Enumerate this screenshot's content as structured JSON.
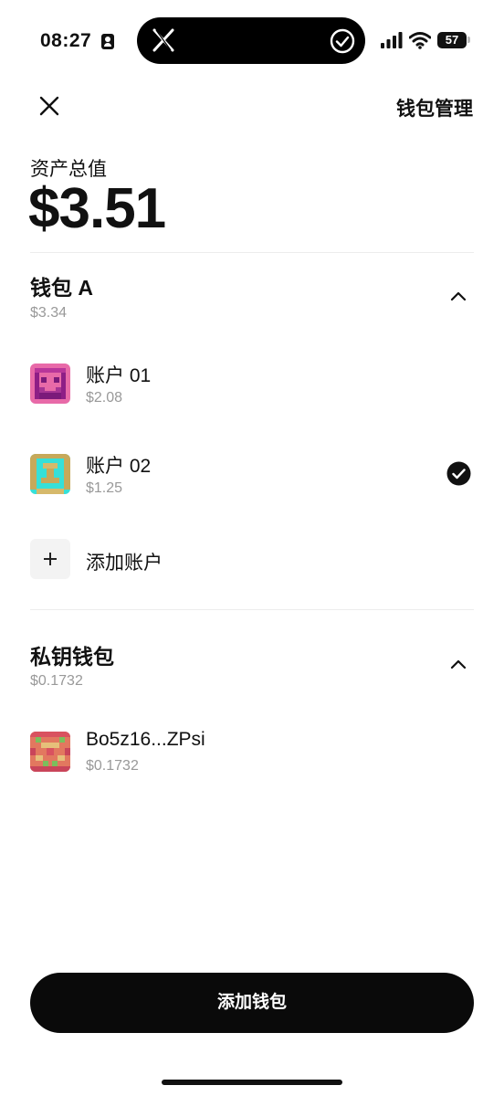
{
  "status_bar": {
    "time": "08:27",
    "battery": "57"
  },
  "header": {
    "manage_label": "钱包管理"
  },
  "total": {
    "label": "资产总值",
    "value": "$3.51"
  },
  "wallet_a": {
    "title": "钱包 A",
    "value": "$3.34",
    "accounts": [
      {
        "name": "账户 01",
        "value": "$2.08",
        "selected": false
      },
      {
        "name": "账户 02",
        "value": "$1.25",
        "selected": true
      }
    ],
    "add_account_label": "添加账户"
  },
  "private_key_wallet": {
    "title": "私钥钱包",
    "value": "$0.1732",
    "accounts": [
      {
        "name": "Bo5z16...ZPsi",
        "value": "$0.1732"
      }
    ]
  },
  "footer": {
    "add_wallet_label": "添加钱包"
  },
  "colors": {
    "primary": "#0a0a0a",
    "muted": "#999999",
    "background": "#ffffff"
  }
}
